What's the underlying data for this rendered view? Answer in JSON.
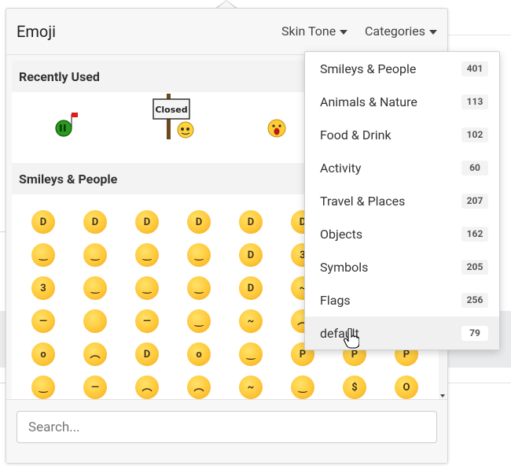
{
  "picker": {
    "title": "Emoji",
    "skin_tone_label": "Skin Tone",
    "categories_label": "Categories",
    "search_placeholder": "Search...",
    "sections": {
      "recently_used": "Recently Used",
      "smileys_people": "Smileys & People"
    },
    "recent_items": [
      {
        "name": "green-alien-flag-emoji"
      },
      {
        "name": "closed-sign-emoji",
        "text": "Closed"
      },
      {
        "name": "screaming-face-emoji"
      }
    ]
  },
  "categories_menu": [
    {
      "label": "Smileys & People",
      "count": "401"
    },
    {
      "label": "Animals & Nature",
      "count": "113"
    },
    {
      "label": "Food & Drink",
      "count": "102"
    },
    {
      "label": "Activity",
      "count": "60"
    },
    {
      "label": "Travel & Places",
      "count": "207"
    },
    {
      "label": "Objects",
      "count": "162"
    },
    {
      "label": "Symbols",
      "count": "205"
    },
    {
      "label": "Flags",
      "count": "256"
    },
    {
      "label": "default",
      "count": "79"
    }
  ],
  "colors": {
    "emoji_yellow": "#ffc93a",
    "hover_bg": "#f0f0f0"
  }
}
